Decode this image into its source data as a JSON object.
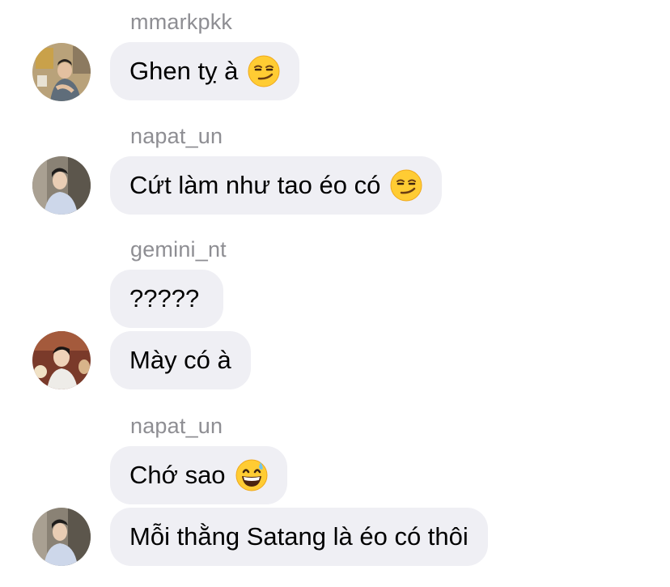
{
  "messages": [
    {
      "sender": "mmarkpkk",
      "text": "Ghen tỵ à",
      "emoji": "smirking-face-emoji"
    },
    {
      "sender": "napat_un",
      "text": "Cứt làm như tao éo có",
      "emoji": "smirking-face-emoji"
    },
    {
      "sender": "gemini_nt",
      "text": "?????"
    },
    {
      "text": "Mày có à"
    },
    {
      "sender": "napat_un",
      "text": "Chớ sao",
      "emoji": "grinning-face-with-sweat-emoji"
    },
    {
      "text": "Mỗi thằng Satang là éo có thôi"
    }
  ],
  "avatars": {
    "mmarkpkk": "avatar-mmarkpkk",
    "napat_un": "avatar-napat_un",
    "gemini_nt": "avatar-gemini_nt"
  },
  "colors": {
    "bubble": "#efeff4",
    "sender_name": "#8e8e93",
    "text": "#000000",
    "background": "#ffffff"
  }
}
